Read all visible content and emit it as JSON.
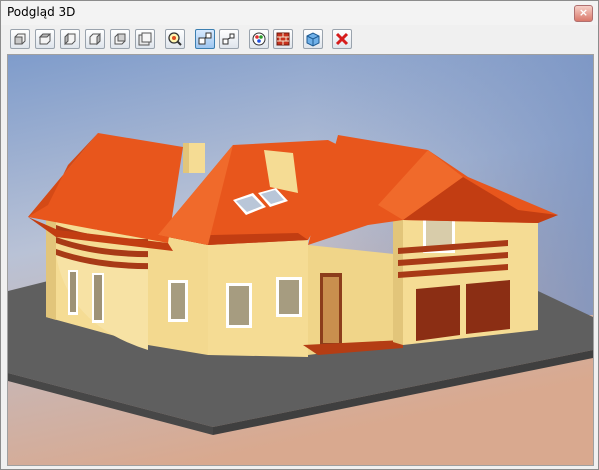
{
  "window": {
    "title": "Podgląd 3D",
    "close_glyph": "×"
  },
  "toolbar": {
    "buttons": [
      {
        "icon": "box-front-view-icon"
      },
      {
        "icon": "box-top-view-icon"
      },
      {
        "icon": "box-left-view-icon"
      },
      {
        "icon": "box-right-view-icon"
      },
      {
        "icon": "box-back-view-icon"
      },
      {
        "icon": "box-fit-view-icon"
      },
      {
        "icon": "zoom-icon"
      },
      {
        "icon": "perspective-near-icon"
      },
      {
        "icon": "perspective-far-icon"
      },
      {
        "icon": "color-palette-icon"
      },
      {
        "icon": "brick-texture-icon"
      },
      {
        "icon": "export-model-icon"
      },
      {
        "icon": "close-red-icon"
      }
    ]
  },
  "colors": {
    "sky_top": "#7f9ccb",
    "sky_mid": "#b9c2d6",
    "ground_bottom": "#d9a98f",
    "roof": "#e8561c",
    "roof_dark": "#c23d12",
    "wall": "#f5dc94",
    "wall_shade": "#e2c57a",
    "garage_door": "#8b2e14",
    "base_plate": "#5f5f5f"
  }
}
